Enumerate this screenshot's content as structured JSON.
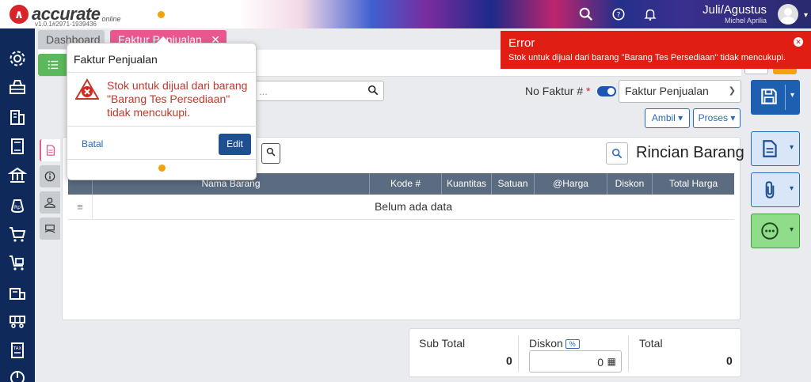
{
  "header": {
    "brand": "accurate",
    "brand_sub": "online",
    "version": "v1.0.1#2971-1939436",
    "period": "Juli/Agustus",
    "user": "Michel Aprilia"
  },
  "tabs": [
    {
      "label": "Dashboard"
    },
    {
      "label": "Faktur Penjualan"
    }
  ],
  "form": {
    "no_faktur_label": "No Faktur #",
    "required_mark": "*",
    "faktur_type": "Faktur Penjualan",
    "search_placeholder": "...",
    "ambil_label": "Ambil",
    "proses_label": "Proses"
  },
  "rincian": {
    "title": "Rincian Barang",
    "columns": [
      "Nama Barang",
      "Kode #",
      "Kuantitas",
      "Satuan",
      "@Harga",
      "Diskon",
      "Total Harga"
    ],
    "empty_text": "Belum ada data"
  },
  "totals": {
    "subtotal_label": "Sub Total",
    "subtotal_value": "0",
    "diskon_label": "Diskon",
    "diskon_badge": "%",
    "diskon_value": "0",
    "total_label": "Total",
    "total_value": "0"
  },
  "popup": {
    "title": "Faktur Penjualan",
    "message": "Stok untuk dijual dari barang \"Barang Tes Persediaan\" tidak mencukupi.",
    "cancel_label": "Batal",
    "edit_label": "Edit"
  },
  "toast": {
    "title": "Error",
    "message": "Stok untuk dijual dari barang \"Barang Tes Persediaan\" tidak mencukupi."
  },
  "colors": {
    "sidebar": "#0f2a5a",
    "tab_active": "#e8588f",
    "primary": "#1d5fb0",
    "error": "#e01e14",
    "success": "#5cb85c"
  }
}
